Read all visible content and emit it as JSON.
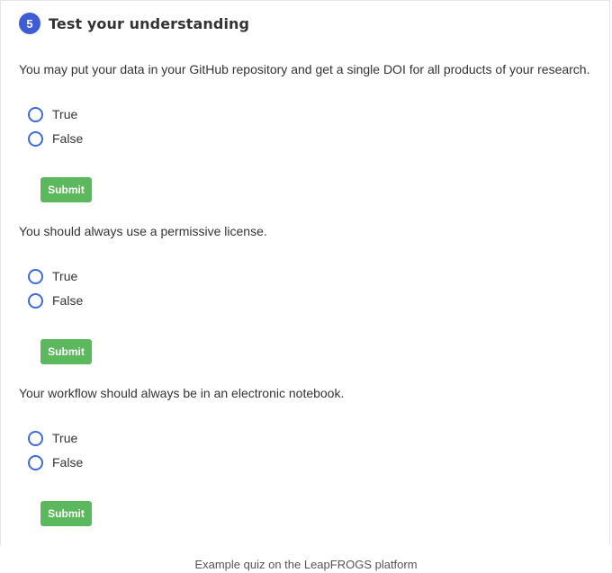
{
  "section": {
    "step_number": "5",
    "title": "Test your understanding"
  },
  "questions": [
    {
      "text": "You may put your data in your GitHub repository and get a single DOI for all products of your research.",
      "options": [
        "True",
        "False"
      ],
      "submit_label": "Submit"
    },
    {
      "text": "You should always use a permissive license.",
      "options": [
        "True",
        "False"
      ],
      "submit_label": "Submit"
    },
    {
      "text": "Your workflow should always be in an electronic notebook.",
      "options": [
        "True",
        "False"
      ],
      "submit_label": "Submit"
    }
  ],
  "caption": "Example quiz on the LeapFROGS platform",
  "colors": {
    "badge": "#3e5bd8",
    "radio_border": "#3e6bd6",
    "submit_bg": "#5cb85c"
  }
}
